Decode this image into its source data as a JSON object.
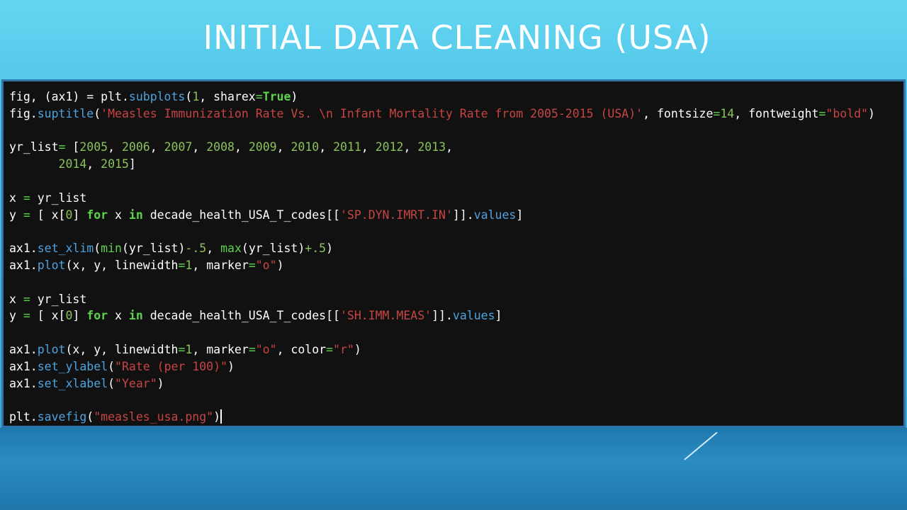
{
  "slide": {
    "title": "INITIAL DATA CLEANING (USA)"
  },
  "code": {
    "lines": [
      [
        {
          "t": "fig, (ax1) = plt.",
          "c": ""
        },
        {
          "t": "subplots",
          "c": "k-fn"
        },
        {
          "t": "(",
          "c": ""
        },
        {
          "t": "1",
          "c": "k-num"
        },
        {
          "t": ", sharex",
          "c": ""
        },
        {
          "t": "=",
          "c": "k-green"
        },
        {
          "t": "True",
          "c": "k-bold"
        },
        {
          "t": ")",
          "c": ""
        }
      ],
      [
        {
          "t": "fig.",
          "c": ""
        },
        {
          "t": "suptitle",
          "c": "k-fn"
        },
        {
          "t": "(",
          "c": ""
        },
        {
          "t": "'Measles Immunization Rate Vs. \\n Infant Mortality Rate from 2005-2015 (USA)'",
          "c": "k-str"
        },
        {
          "t": ", fontsize",
          "c": ""
        },
        {
          "t": "=",
          "c": "k-green"
        },
        {
          "t": "14",
          "c": "k-num"
        },
        {
          "t": ", fontweight",
          "c": ""
        },
        {
          "t": "=",
          "c": "k-green"
        },
        {
          "t": "\"bold\"",
          "c": "k-str"
        },
        {
          "t": ")",
          "c": ""
        }
      ],
      [],
      [
        {
          "t": "yr_list",
          "c": ""
        },
        {
          "t": "=",
          "c": "k-green"
        },
        {
          "t": " [",
          "c": ""
        },
        {
          "t": "2005",
          "c": "k-num"
        },
        {
          "t": ", ",
          "c": ""
        },
        {
          "t": "2006",
          "c": "k-num"
        },
        {
          "t": ", ",
          "c": ""
        },
        {
          "t": "2007",
          "c": "k-num"
        },
        {
          "t": ", ",
          "c": ""
        },
        {
          "t": "2008",
          "c": "k-num"
        },
        {
          "t": ", ",
          "c": ""
        },
        {
          "t": "2009",
          "c": "k-num"
        },
        {
          "t": ", ",
          "c": ""
        },
        {
          "t": "2010",
          "c": "k-num"
        },
        {
          "t": ", ",
          "c": ""
        },
        {
          "t": "2011",
          "c": "k-num"
        },
        {
          "t": ", ",
          "c": ""
        },
        {
          "t": "2012",
          "c": "k-num"
        },
        {
          "t": ", ",
          "c": ""
        },
        {
          "t": "2013",
          "c": "k-num"
        },
        {
          "t": ",",
          "c": ""
        }
      ],
      [
        {
          "t": "       ",
          "c": ""
        },
        {
          "t": "2014",
          "c": "k-num"
        },
        {
          "t": ", ",
          "c": ""
        },
        {
          "t": "2015",
          "c": "k-num"
        },
        {
          "t": "]",
          "c": ""
        }
      ],
      [],
      [
        {
          "t": "x ",
          "c": ""
        },
        {
          "t": "=",
          "c": "k-green"
        },
        {
          "t": " yr_list",
          "c": ""
        }
      ],
      [
        {
          "t": "y ",
          "c": ""
        },
        {
          "t": "=",
          "c": "k-green"
        },
        {
          "t": " [ x[",
          "c": ""
        },
        {
          "t": "0",
          "c": "k-num"
        },
        {
          "t": "] ",
          "c": ""
        },
        {
          "t": "for",
          "c": "k-bold"
        },
        {
          "t": " x ",
          "c": ""
        },
        {
          "t": "in",
          "c": "k-bold"
        },
        {
          "t": " decade_health_USA_T_codes[[",
          "c": ""
        },
        {
          "t": "'SP.DYN.IMRT.IN'",
          "c": "k-str"
        },
        {
          "t": "]].",
          "c": ""
        },
        {
          "t": "values",
          "c": "k-fn"
        },
        {
          "t": "]",
          "c": ""
        }
      ],
      [],
      [
        {
          "t": "ax1.",
          "c": ""
        },
        {
          "t": "set_xlim",
          "c": "k-fn"
        },
        {
          "t": "(",
          "c": ""
        },
        {
          "t": "min",
          "c": "k-green"
        },
        {
          "t": "(yr_list)",
          "c": ""
        },
        {
          "t": "-.5",
          "c": "k-num"
        },
        {
          "t": ", ",
          "c": ""
        },
        {
          "t": "max",
          "c": "k-green"
        },
        {
          "t": "(yr_list)",
          "c": ""
        },
        {
          "t": "+.5",
          "c": "k-num"
        },
        {
          "t": ")",
          "c": ""
        }
      ],
      [
        {
          "t": "ax1.",
          "c": ""
        },
        {
          "t": "plot",
          "c": "k-fn"
        },
        {
          "t": "(x, y, linewidth",
          "c": ""
        },
        {
          "t": "=",
          "c": "k-green"
        },
        {
          "t": "1",
          "c": "k-num"
        },
        {
          "t": ", marker",
          "c": ""
        },
        {
          "t": "=",
          "c": "k-green"
        },
        {
          "t": "\"o\"",
          "c": "k-str"
        },
        {
          "t": ")",
          "c": ""
        }
      ],
      [],
      [
        {
          "t": "x ",
          "c": ""
        },
        {
          "t": "=",
          "c": "k-green"
        },
        {
          "t": " yr_list",
          "c": ""
        }
      ],
      [
        {
          "t": "y ",
          "c": ""
        },
        {
          "t": "=",
          "c": "k-green"
        },
        {
          "t": " [ x[",
          "c": ""
        },
        {
          "t": "0",
          "c": "k-num"
        },
        {
          "t": "] ",
          "c": ""
        },
        {
          "t": "for",
          "c": "k-bold"
        },
        {
          "t": " x ",
          "c": ""
        },
        {
          "t": "in",
          "c": "k-bold"
        },
        {
          "t": " decade_health_USA_T_codes[[",
          "c": ""
        },
        {
          "t": "'SH.IMM.MEAS'",
          "c": "k-str"
        },
        {
          "t": "]].",
          "c": ""
        },
        {
          "t": "values",
          "c": "k-fn"
        },
        {
          "t": "]",
          "c": ""
        }
      ],
      [],
      [
        {
          "t": "ax1.",
          "c": ""
        },
        {
          "t": "plot",
          "c": "k-fn"
        },
        {
          "t": "(x, y, linewidth",
          "c": ""
        },
        {
          "t": "=",
          "c": "k-green"
        },
        {
          "t": "1",
          "c": "k-num"
        },
        {
          "t": ", marker",
          "c": ""
        },
        {
          "t": "=",
          "c": "k-green"
        },
        {
          "t": "\"o\"",
          "c": "k-str"
        },
        {
          "t": ", color",
          "c": ""
        },
        {
          "t": "=",
          "c": "k-green"
        },
        {
          "t": "\"r\"",
          "c": "k-str"
        },
        {
          "t": ")",
          "c": ""
        }
      ],
      [
        {
          "t": "ax1.",
          "c": ""
        },
        {
          "t": "set_ylabel",
          "c": "k-fn"
        },
        {
          "t": "(",
          "c": ""
        },
        {
          "t": "\"Rate (per 100)\"",
          "c": "k-str"
        },
        {
          "t": ")",
          "c": ""
        }
      ],
      [
        {
          "t": "ax1.",
          "c": ""
        },
        {
          "t": "set_xlabel",
          "c": "k-fn"
        },
        {
          "t": "(",
          "c": ""
        },
        {
          "t": "\"Year\"",
          "c": "k-str"
        },
        {
          "t": ")",
          "c": ""
        }
      ],
      [],
      [
        {
          "t": "plt.",
          "c": ""
        },
        {
          "t": "savefig",
          "c": "k-fn"
        },
        {
          "t": "(",
          "c": ""
        },
        {
          "t": "\"measles_usa.png\"",
          "c": "k-str"
        },
        {
          "t": ")",
          "c": ""
        }
      ]
    ]
  }
}
